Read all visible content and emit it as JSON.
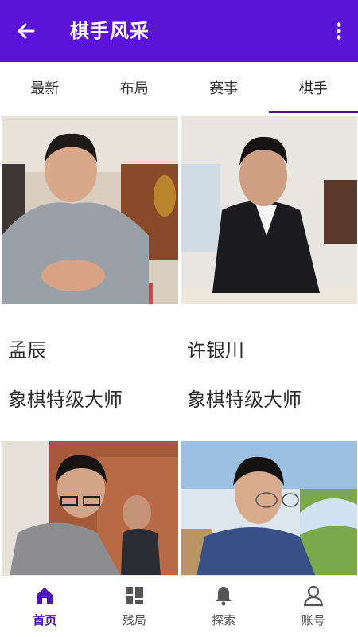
{
  "appbar": {
    "title": "棋手风采",
    "back_icon": "arrow-back-icon",
    "more_icon": "more-vert-icon",
    "color": "#5b13d8"
  },
  "tabs": [
    {
      "label": "最新",
      "active": false
    },
    {
      "label": "布局",
      "active": false
    },
    {
      "label": "赛事",
      "active": false
    },
    {
      "label": "棋手",
      "active": true
    }
  ],
  "players": [
    {
      "name": "孟辰",
      "rank": "象棋特级大师"
    },
    {
      "name": "许银川",
      "rank": "象棋特级大师"
    },
    {
      "name": "",
      "rank": ""
    },
    {
      "name": "",
      "rank": ""
    }
  ],
  "bottom_nav": [
    {
      "label": "首页",
      "icon": "home-icon",
      "active": true
    },
    {
      "label": "残局",
      "icon": "grid-icon",
      "active": false
    },
    {
      "label": "探索",
      "icon": "bell-icon",
      "active": false
    },
    {
      "label": "账号",
      "icon": "person-icon",
      "active": false
    }
  ],
  "colors": {
    "accent": "#5b13d8",
    "nav_active": "#4b14b8",
    "tab_indicator": "#4a168a"
  }
}
